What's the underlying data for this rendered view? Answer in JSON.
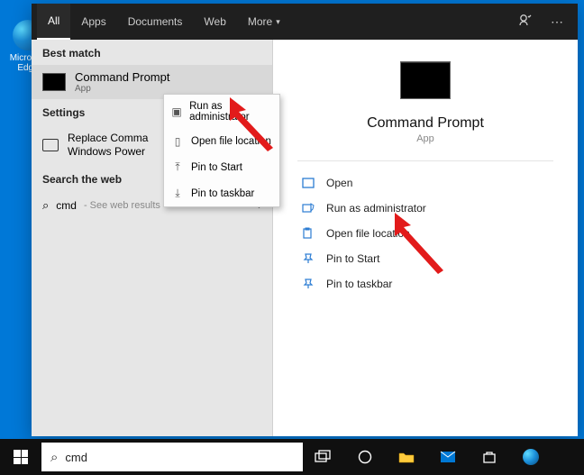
{
  "desktop": {
    "edge_label": "Microsoft Edge"
  },
  "header": {
    "tabs": [
      "All",
      "Apps",
      "Documents",
      "Web",
      "More"
    ]
  },
  "left": {
    "best_match": "Best match",
    "result_title": "Command Prompt",
    "result_sub": "App",
    "settings_head": "Settings",
    "settings_item": "Replace Command Prompt with Windows PowerShell...",
    "settings_item_visible": "Replace Comma\nWindows Power",
    "search_web_head": "Search the web",
    "web_query": "cmd",
    "web_sub": "- See web results"
  },
  "context": {
    "items": [
      "Run as administrator",
      "Open file location",
      "Pin to Start",
      "Pin to taskbar"
    ]
  },
  "right": {
    "title": "Command Prompt",
    "sub": "App",
    "actions": [
      "Open",
      "Run as administrator",
      "Open file location",
      "Pin to Start",
      "Pin to taskbar"
    ]
  },
  "taskbar": {
    "search_value": "cmd"
  }
}
